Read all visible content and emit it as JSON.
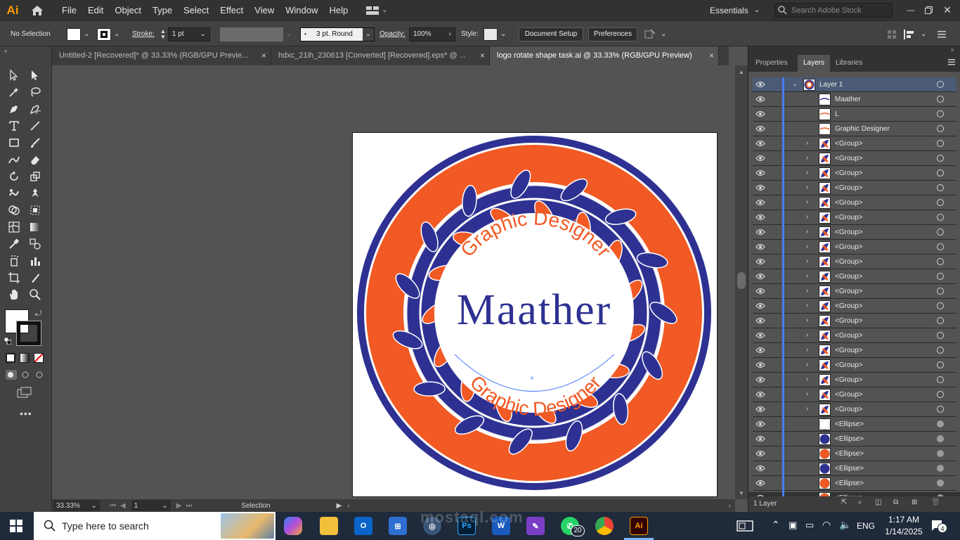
{
  "app": {
    "logo": "Ai"
  },
  "menu": [
    "File",
    "Edit",
    "Object",
    "Type",
    "Select",
    "Effect",
    "View",
    "Window",
    "Help"
  ],
  "workspace": {
    "label": "Essentials",
    "search_placeholder": "Search Adobe Stock"
  },
  "control": {
    "selection": "No Selection",
    "stroke_label": "Stroke:",
    "stroke_value": "1 pt",
    "brush_value": "3 pt. Round",
    "opacity_label": "Opacity:",
    "opacity_value": "100%",
    "style_label": "Style:",
    "document_setup": "Document Setup",
    "preferences": "Preferences"
  },
  "tabs": [
    {
      "label": "Untitled-2 [Recovered]* @ 33.33% (RGB/GPU Previe..."
    },
    {
      "label": "hdxc_21ih_230613 [Converted] [Recovered].eps* @ ..."
    },
    {
      "label": "logo rotate shape task.ai @ 33.33% (RGB/GPU Preview)"
    }
  ],
  "tab_close": "×",
  "artwork": {
    "main_text": "Maather",
    "arc_text_top": "Graphic Designer",
    "arc_text_bottom": "Graphic Designer",
    "colors": {
      "navy": "#2e3192",
      "orange": "#f15a24",
      "white": "#ffffff"
    }
  },
  "status": {
    "zoom": "33.33%",
    "artboard": "1",
    "tool": "Selection"
  },
  "panel": {
    "tabs": [
      "Properties",
      "Layers",
      "Libraries"
    ],
    "footer": "1 Layer",
    "layers": [
      {
        "name": "Layer 1",
        "kind": "layer"
      },
      {
        "name": "Maather",
        "kind": "text"
      },
      {
        "name": "L",
        "kind": "text"
      },
      {
        "name": "Graphic Designer",
        "kind": "text"
      },
      {
        "name": "<Group>",
        "kind": "group"
      },
      {
        "name": "<Group>",
        "kind": "group"
      },
      {
        "name": "<Group>",
        "kind": "group"
      },
      {
        "name": "<Group>",
        "kind": "group"
      },
      {
        "name": "<Group>",
        "kind": "group"
      },
      {
        "name": "<Group>",
        "kind": "group"
      },
      {
        "name": "<Group>",
        "kind": "group"
      },
      {
        "name": "<Group>",
        "kind": "group"
      },
      {
        "name": "<Group>",
        "kind": "group"
      },
      {
        "name": "<Group>",
        "kind": "group"
      },
      {
        "name": "<Group>",
        "kind": "group"
      },
      {
        "name": "<Group>",
        "kind": "group"
      },
      {
        "name": "<Group>",
        "kind": "group"
      },
      {
        "name": "<Group>",
        "kind": "group"
      },
      {
        "name": "<Group>",
        "kind": "group"
      },
      {
        "name": "<Group>",
        "kind": "group"
      },
      {
        "name": "<Group>",
        "kind": "group"
      },
      {
        "name": "<Group>",
        "kind": "group"
      },
      {
        "name": "<Group>",
        "kind": "group"
      },
      {
        "name": "<Ellipse>",
        "kind": "ellipse",
        "color": "#ffffff"
      },
      {
        "name": "<Ellipse>",
        "kind": "ellipse",
        "color": "#2e3192"
      },
      {
        "name": "<Ellipse>",
        "kind": "ellipse",
        "color": "#f15a24"
      },
      {
        "name": "<Ellipse>",
        "kind": "ellipse",
        "color": "#2e3192"
      },
      {
        "name": "<Ellipse>",
        "kind": "ellipse",
        "color": "#f15a24"
      },
      {
        "name": "<Ellipse>",
        "kind": "ellipse",
        "color": "#f15a24"
      }
    ]
  },
  "taskbar": {
    "search_placeholder": "Type here to search",
    "whatsapp_badge": "20",
    "language": "ENG",
    "time": "1:17 AM",
    "date": "1/14/2025",
    "notification_count": "4"
  },
  "watermark": {
    "text": "mostaql.com"
  }
}
